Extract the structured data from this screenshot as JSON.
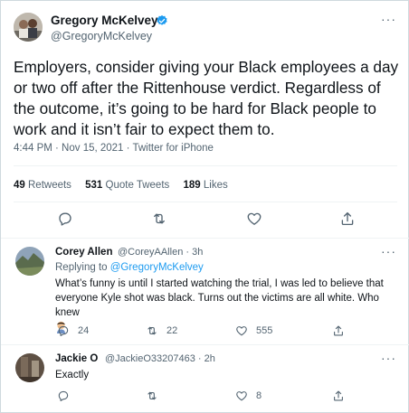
{
  "colors": {
    "accent": "#1d9bf0",
    "text": "#0f1419",
    "secondary": "#536471",
    "divider": "#eff3f4"
  },
  "main_tweet": {
    "display_name": "Gregory McKelvey",
    "handle": "@GregoryMcKelvey",
    "verified_icon": "verified-badge-icon",
    "more_label": "···",
    "text_lines": [
      "Employers, consider giving your Black employees a day",
      "or two off after the Rittenhouse verdict. Regardless of",
      "the outcome, it’s going to be hard for Black people to",
      "work and it isn’t fair to expect them to."
    ],
    "meta": "4:44 PM · Nov 15, 2021 · Twitter for iPhone",
    "stats": {
      "retweets_count": "49",
      "retweets_label": "Retweets",
      "quotes_count": "531",
      "quotes_label": "Quote Tweets",
      "likes_count": "189",
      "likes_label": "Likes"
    },
    "actions": [
      "reply-icon",
      "retweet-icon",
      "like-icon",
      "share-icon"
    ]
  },
  "replies": [
    {
      "display_name": "Corey Allen",
      "handle_time": "@CoreyAAllen · 3h",
      "replying_prefix": "Replying to ",
      "replying_mention": "@GregoryMcKelvey",
      "text_lines": [
        "What’s funny is until I started watching the trial, I was led to believe that",
        "everyone Kyle shot was black. Turns out the victims are all white. Who knew"
      ],
      "emoji_icon": "facepalm-emoji-icon",
      "more_label": "···",
      "reply_count": "24",
      "retweet_count": "22",
      "like_count": "555"
    },
    {
      "display_name": "Jackie O",
      "handle_time": "@JackieO33207463 · 2h",
      "text_lines": [
        "Exactly"
      ],
      "more_label": "···",
      "like_count": "8"
    }
  ]
}
